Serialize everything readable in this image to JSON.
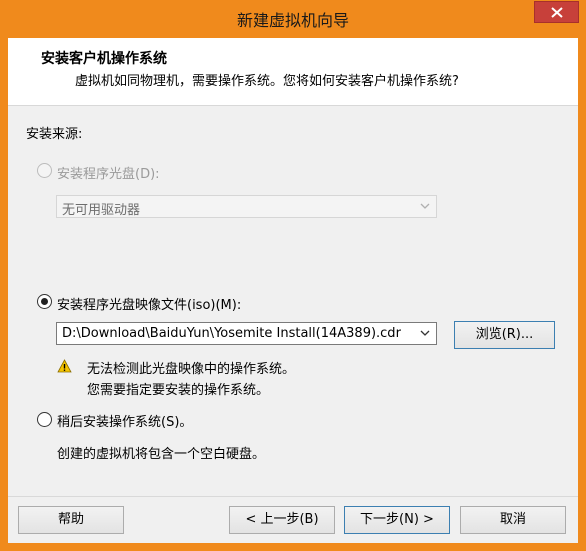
{
  "window": {
    "title": "新建虚拟机向导"
  },
  "header": {
    "title": "安装客户机操作系统",
    "subtitle": "虚拟机如同物理机，需要操作系统。您将如何安装客户机操作系统?"
  },
  "source_label": "安装来源:",
  "option_disc": {
    "label": "安装程序光盘(D):",
    "selected": false,
    "enabled": false,
    "dropdown_value": "无可用驱动器"
  },
  "option_iso": {
    "label": "安装程序光盘映像文件(iso)(M):",
    "selected": true,
    "path_value": "D:\\Download\\BaiduYun\\Yosemite Install(14A389).cdr",
    "browse_label": "浏览(R)...",
    "warning_line1": "无法检测此光盘映像中的操作系统。",
    "warning_line2": "您需要指定要安装的操作系统。"
  },
  "option_later": {
    "label": "稍后安装操作系统(S)。",
    "selected": false,
    "description": "创建的虚拟机将包含一个空白硬盘。"
  },
  "footer": {
    "help_label": "帮助",
    "back_label": "< 上一步(B)",
    "next_label": "下一步(N) >",
    "cancel_label": "取消"
  },
  "colors": {
    "titlebar": "#f08a1c",
    "close_button": "#c7403a",
    "warning": "#f5c400"
  },
  "icons": [
    "close-icon",
    "chevron-down-icon",
    "warning-icon"
  ]
}
